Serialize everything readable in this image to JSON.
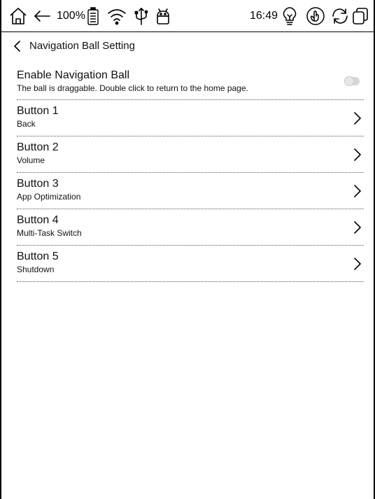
{
  "status_bar": {
    "battery_percent": "100%",
    "time": "16:49",
    "icons": [
      "home-icon",
      "back-arrow-icon",
      "battery-icon",
      "wifi-icon",
      "usb-icon",
      "android-icon",
      "lightbulb-icon",
      "touch-icon",
      "refresh-icon",
      "recent-apps-icon"
    ]
  },
  "header": {
    "title": "Navigation Ball Setting"
  },
  "enable_row": {
    "title": "Enable Navigation Ball",
    "description": "The ball is draggable. Double click to return to the home page.",
    "enabled": false
  },
  "buttons": [
    {
      "label": "Button 1",
      "action": "Back"
    },
    {
      "label": "Button 2",
      "action": "Volume"
    },
    {
      "label": "Button 3",
      "action": "App Optimization"
    },
    {
      "label": "Button 4",
      "action": "Multi-Task Switch"
    },
    {
      "label": "Button 5",
      "action": "Shutdown"
    }
  ]
}
